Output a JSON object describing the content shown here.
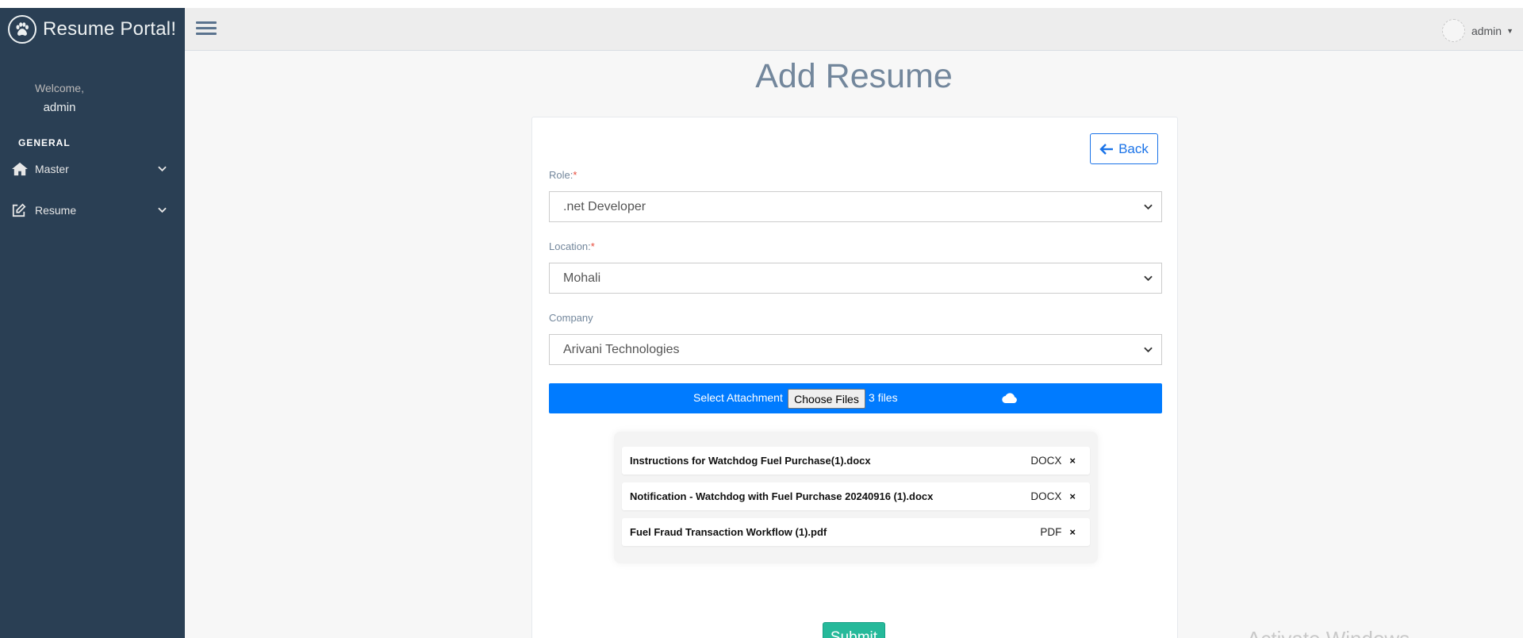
{
  "brand": {
    "title": "Resume Portal!",
    "logo_icon": "paw-icon"
  },
  "sidebar": {
    "welcome_label": "Welcome,",
    "welcome_user": "admin",
    "section_title": "GENERAL",
    "items": [
      {
        "label": "Master",
        "icon": "home-icon"
      },
      {
        "label": "Resume",
        "icon": "edit-icon"
      }
    ]
  },
  "topnav": {
    "user_name": "admin"
  },
  "page": {
    "title": "Add Resume"
  },
  "form": {
    "back_label": "Back",
    "role": {
      "label": "Role:",
      "required_mark": "*",
      "value": ".net Developer"
    },
    "location": {
      "label": "Location:",
      "required_mark": "*",
      "value": "Mohali"
    },
    "company": {
      "label": "Company",
      "value": "Arivani Technologies"
    },
    "attachment": {
      "label": "Select Attachment",
      "choose_label": "Choose Files",
      "files_count": "3 files"
    },
    "files": [
      {
        "name": "Instructions for Watchdog Fuel Purchase(1).docx",
        "type": "DOCX",
        "remove": "×"
      },
      {
        "name": "Notification - Watchdog with Fuel Purchase 20240916 (1).docx",
        "type": "DOCX",
        "remove": "×"
      },
      {
        "name": "Fuel Fraud Transaction Workflow (1).pdf",
        "type": "PDF",
        "remove": "×"
      }
    ],
    "submit_label": "Submit"
  },
  "watermark": {
    "text": "Activate Windows"
  },
  "colors": {
    "sidebar": "#2a3f54",
    "primary": "#007bff",
    "success": "#26b99a",
    "title": "#73879c"
  }
}
